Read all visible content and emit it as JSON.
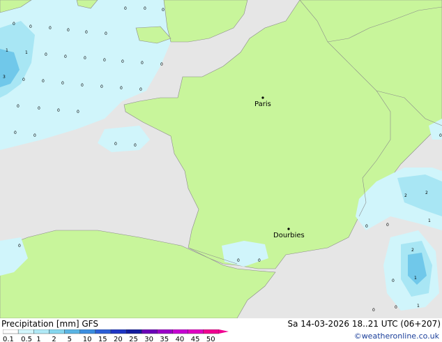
{
  "map": {
    "cities": [
      {
        "name": "Paris"
      },
      {
        "name": "Dourbies"
      }
    ],
    "colors": {
      "sea": "#e6e6e6",
      "land": "#c8f59b",
      "precip_light": "#d0f5fb",
      "precip_mid": "#a8e6f4",
      "precip_high": "#70c8ea",
      "border": "#8a8a8a"
    },
    "precip_values": [
      "0",
      "1",
      "2",
      "3"
    ]
  },
  "footer": {
    "title": "Precipitation [mm]  GFS",
    "datetime": "Sa 14-03-2026 18..21 UTC (06+207)",
    "credit": "©weatheronline.co.uk"
  },
  "legend": {
    "ticks": [
      "0.1",
      "0.5",
      "1",
      "2",
      "5",
      "10",
      "15",
      "20",
      "25",
      "30",
      "35",
      "40",
      "45",
      "50"
    ],
    "colors": [
      "#fefefe",
      "#d3f7fd",
      "#b1eaf7",
      "#86d7ef",
      "#5ab4e3",
      "#3c8ee0",
      "#2c5fd6",
      "#1f36c4",
      "#131c9e",
      "#6a00b8",
      "#9a00c8",
      "#c600d2",
      "#e000c2",
      "#f00090"
    ]
  }
}
